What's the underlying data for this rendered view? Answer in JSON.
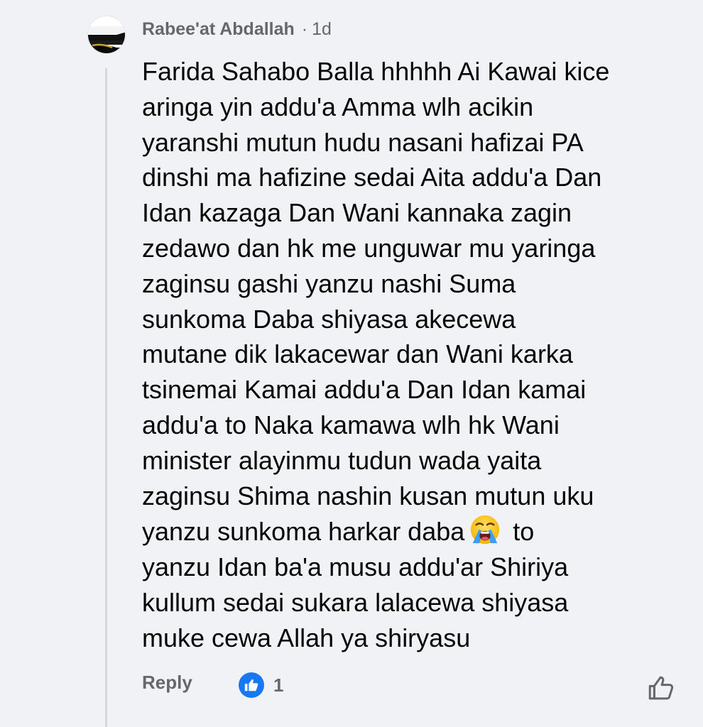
{
  "comment": {
    "author": "Rabee'at Abdallah",
    "separator": "·",
    "time": "1d",
    "text_part1": "Farida Sahabo Balla hhhhh Ai Kawai kice\naringa yin addu'a Amma wlh acikin\nyaranshi mutun hudu nasani hafizai PA\ndinshi ma hafizine sedai Aita addu'a Dan\nIdan kazaga Dan Wani kannaka zagin\nzedawo dan hk me unguwar mu yaringa\nzaginsu gashi yanzu nashi Suma\nsunkoma Daba shiyasa akecewa\nmutane dik lakacewar dan Wani karka\ntsinemai Kamai addu'a Dan Idan kamai\naddu'a to Naka kamawa wlh hk Wani\nminister alayinmu tudun wada yaita\nzaginsu Shima nashin kusan mutun uku\nyanzu sunkoma harkar daba",
    "emoji": "loudly-crying-face",
    "text_part2": " to\nyanzu Idan ba'a musu addu'ar Shiriya\nkullum sedai sukara lalacewa shiyasa\nmuke cewa Allah ya shiryasu"
  },
  "actions": {
    "reply_label": "Reply",
    "reaction_icon": "like-icon",
    "reaction_count": "1",
    "like_button_icon": "thumbs-up-outline-icon"
  },
  "colors": {
    "background": "#f0f2f5",
    "text": "#050505",
    "secondary_text": "#65676b",
    "like_blue": "#1877f2",
    "thread_line": "#d3d6db"
  }
}
